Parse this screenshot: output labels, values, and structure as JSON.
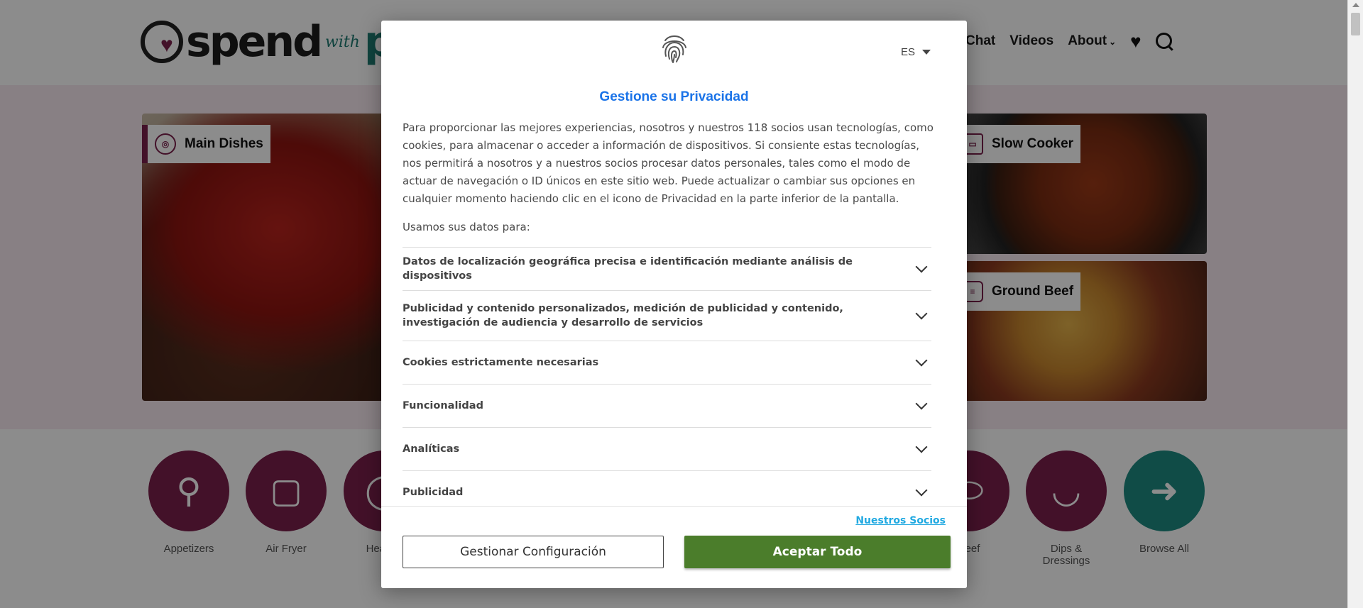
{
  "site": {
    "logo_word": "spend",
    "logo_with": "with",
    "logo_tail": "p",
    "nav": {
      "items": [
        "Chat",
        "Videos",
        "About"
      ],
      "heart_icon": "heart-icon",
      "search_icon": "search-icon"
    }
  },
  "hero": {
    "tiles": [
      {
        "label": "Main Dishes",
        "icon": "plate-icon"
      },
      {
        "label": "Slow Cooker",
        "icon": "slow-cooker-icon"
      },
      {
        "label": "Ground Beef",
        "icon": "burger-icon"
      }
    ]
  },
  "categories": [
    {
      "label": "Appetizers",
      "icon": "skewer-icon"
    },
    {
      "label": "Air Fryer",
      "icon": "air-fryer-icon"
    },
    {
      "label": "Healthy",
      "icon": "apple-icon"
    },
    {
      "label": "Beef",
      "icon": "steak-icon"
    },
    {
      "label": "Dips & Dressings",
      "icon": "dip-bowl-icon"
    },
    {
      "label": "Browse All",
      "icon": "arrow-right-icon"
    }
  ],
  "consent": {
    "language": "ES",
    "title": "Gestione su Privacidad",
    "intro": "Para proporcionar las mejores experiencias, nosotros y nuestros 118 socios usan tecnologías, como cookies, para almacenar o acceder a información de dispositivos. Si consiente estas tecnologías, nos permitirá a nosotros y a nuestros socios procesar datos personales, tales como el modo de actuar de navegación o ID únicos en este sitio web. Puede actualizar o cambiar sus opciones en cualquier momento haciendo clic en el icono de Privacidad en la parte inferior de la pantalla.",
    "usamos": "Usamos sus datos para:",
    "purposes": [
      "Datos de localización geográfica precisa e identificación mediante análisis de dispositivos",
      "Publicidad y contenido personalizados, medición de publicidad y contenido, investigación de audiencia y desarrollo de servicios",
      "Cookies estrictamente necesarias",
      "Funcionalidad",
      "Analíticas",
      "Publicidad"
    ],
    "partners_link": "Nuestros Socios",
    "manage_button": "Gestionar Configuración",
    "accept_button": "Aceptar Todo",
    "accept_color": "#4b7d2b",
    "title_color": "#1a73e8",
    "link_color": "#21a9e1"
  }
}
